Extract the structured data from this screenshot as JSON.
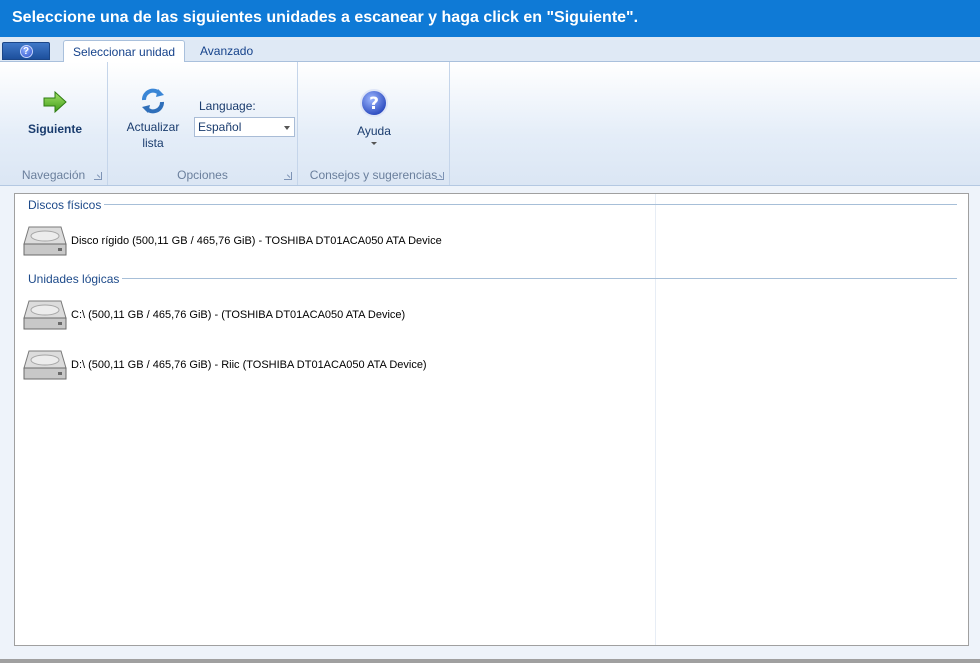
{
  "title_bar": {
    "text": "Seleccione una de las siguientes unidades a escanear y haga click en \"Siguiente\"."
  },
  "tabs": [
    {
      "label": "Seleccionar unidad",
      "active": true
    },
    {
      "label": "Avanzado",
      "active": false
    }
  ],
  "ribbon": {
    "navigation": {
      "label": "Navegación",
      "next_label": "Siguiente"
    },
    "options": {
      "label": "Opciones",
      "refresh_line1": "Actualizar",
      "refresh_line2": "lista",
      "language_label": "Language:",
      "language_value": "Español"
    },
    "tips": {
      "label": "Consejos y sugerencias",
      "help_label": "Ayuda"
    }
  },
  "physical_disks": {
    "header": "Discos físicos",
    "items": [
      "Disco rígido (500,11 GB / 465,76 GiB) - TOSHIBA DT01ACA050 ATA Device"
    ]
  },
  "logical_drives": {
    "header": "Unidades lógicas",
    "items": [
      "C:\\ (500,11 GB / 465,76 GiB) -  (TOSHIBA DT01ACA050 ATA Device)",
      "D:\\ (500,11 GB / 465,76 GiB) - Riic (TOSHIBA DT01ACA050 ATA Device)"
    ]
  },
  "colors": {
    "title_bar": "#0f7ad6",
    "accent_text": "#1d4a8a",
    "ribbon_bg": "#e4edf8"
  }
}
